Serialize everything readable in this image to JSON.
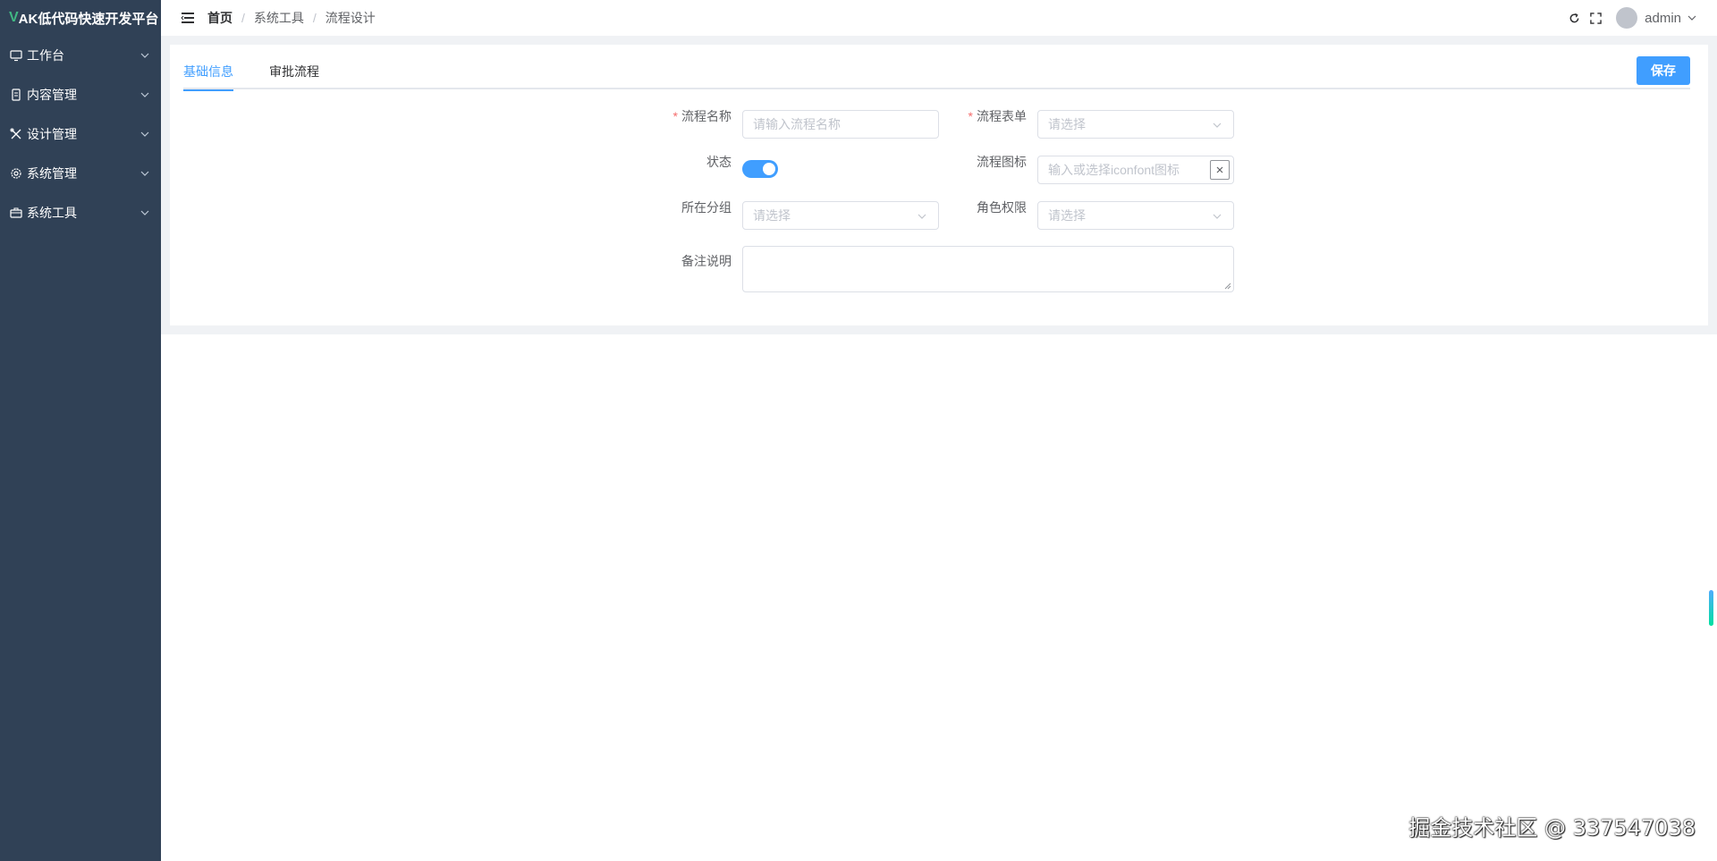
{
  "sidebar": {
    "logo_v": "V",
    "logo_text": "AK低代码快速开发平台",
    "items": [
      {
        "label": "工作台",
        "icon": "monitor-icon"
      },
      {
        "label": "内容管理",
        "icon": "document-icon"
      },
      {
        "label": "设计管理",
        "icon": "tools-icon"
      },
      {
        "label": "系统管理",
        "icon": "gear-icon"
      },
      {
        "label": "系统工具",
        "icon": "toolbox-icon"
      }
    ]
  },
  "header": {
    "breadcrumb": [
      "首页",
      "系统工具",
      "流程设计"
    ],
    "separator": "/",
    "username": "admin"
  },
  "tabs": {
    "basic": "基础信息",
    "approval": "审批流程"
  },
  "save_label": "保存",
  "form": {
    "name_label": "流程名称",
    "name_placeholder": "请输入流程名称",
    "form_label": "流程表单",
    "form_placeholder": "请选择",
    "status_label": "状态",
    "status_on": true,
    "icon_label": "流程图标",
    "icon_placeholder": "输入或选择iconfont图标",
    "group_label": "所在分组",
    "group_placeholder": "请选择",
    "role_label": "角色权限",
    "role_placeholder": "请选择",
    "remark_label": "备注说明",
    "required_mark": "*"
  },
  "watermark": "掘金技术社区 @ 337547038",
  "colors": {
    "sidebar_bg": "#304156",
    "accent": "#409eff",
    "required": "#f56c6c"
  }
}
